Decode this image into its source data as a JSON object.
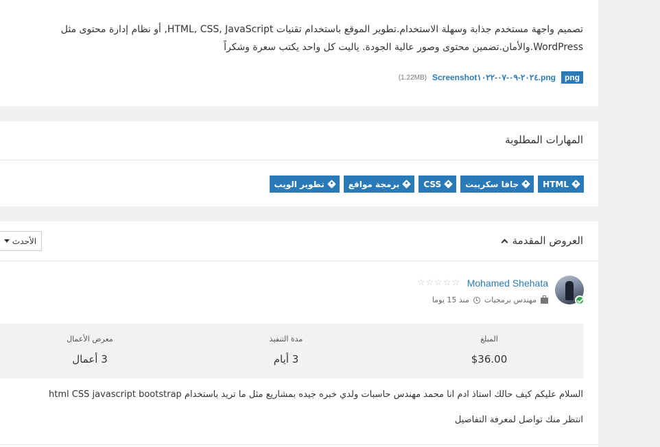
{
  "description": {
    "text": "تصميم واجهة مستخدم جذابة وسهلة الاستخدام.تطوير الموقع باستخدام تقنيات HTML, CSS, JavaScript, أو نظام إدارة محتوى مثل WordPress.والأمان.تضمين محتوى وصور عالية الجودة. ياليت كل واحد يكتب سعرة وشكراً",
    "attachment": {
      "ext": "png",
      "filename": "Screenshot٢٠٢٤-٠٩-٠٧-١٠٢٢.png",
      "size": "(1.22MB)"
    }
  },
  "skills": {
    "title": "المهارات المطلوبة",
    "tags": [
      "HTML",
      "جافا سكريبت",
      "CSS",
      "برمجة مواقع",
      "تطوير الويب"
    ]
  },
  "offers": {
    "title": "العروض المقدمة",
    "sort_label": "الأحدث",
    "offer": {
      "name": "Mohamed Shehata",
      "rating": 0,
      "rating_max": 5,
      "job": "مهندس برمجيات",
      "time": "منذ 15 يوما",
      "stats": [
        {
          "label": "المبلغ",
          "value": "$36.00"
        },
        {
          "label": "مدة التنفيذ",
          "value": "3 أيام"
        },
        {
          "label": "معرض الأعمال",
          "value": "3 أعمال"
        }
      ],
      "message_1": "السلام عليكم كيف حالك استاذ ادم انا محمد مهندس حاسبات ولدي خبره جيده بمشاريع مثل ما تريد باستخدام html CSS javascript bootstrap",
      "message_2": "انتظر منك تواصل لمعرفة التفاصيل"
    }
  },
  "colors": {
    "accent": "#2a7ab8",
    "verified": "#2ea84a",
    "page_bg": "#f0f0f0"
  }
}
